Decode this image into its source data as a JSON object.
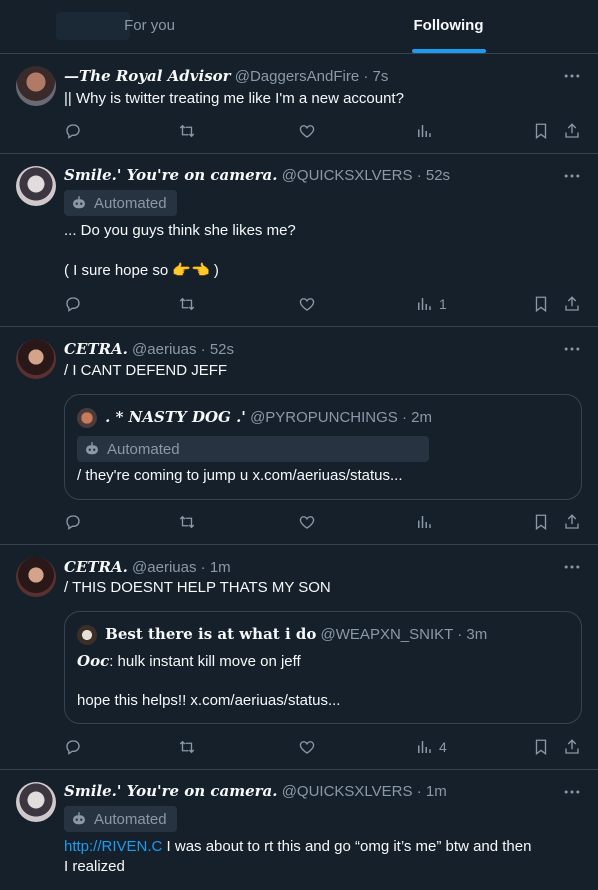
{
  "tabs": [
    {
      "label": "For you",
      "active": false
    },
    {
      "label": "Following",
      "active": true
    }
  ],
  "colors": {
    "background": "#15202b",
    "accent": "#1d9bf0",
    "muted": "#8b98a5",
    "border": "#38444d"
  },
  "tweets": [
    {
      "name": "—The Royal Advisor",
      "handle": "@DaggersAndFire",
      "time": "· 7s",
      "text": "|| Why is twitter treating me like I'm a new account?",
      "actions": {
        "reply": "",
        "retweet": "",
        "like": "",
        "views": ""
      }
    },
    {
      "name": "Smile.' You're on camera.",
      "handle": "@QUICKSXLVERS",
      "time": "· 52s",
      "badge": "Automated",
      "text_line1": "... Do you guys think she likes me?",
      "text_line2": "( I sure hope so",
      "text_emoji": "👉👈",
      "text_line2_end": " )",
      "actions": {
        "views": "1"
      }
    },
    {
      "name": "CETRA.",
      "handle": "@aeriuas",
      "time": "· 52s",
      "text": "/ I CANT DEFEND JEFF",
      "quote": {
        "name": ". * NASTY DOG .'",
        "handle": "@PYROPUNCHINGS",
        "time": "· 2m",
        "badge": "Automated",
        "text": "/ they're coming to jump u x.com/aeriuas/status..."
      },
      "actions": {
        "views": ""
      }
    },
    {
      "name": "CETRA.",
      "handle": "@aeriuas",
      "time": "· 1m",
      "text": "/ THIS DOESNT HELP THATS MY SON",
      "quote": {
        "name": "Best there is at what i do",
        "handle": "@WEAPXN_SNIKT",
        "time": "· 3m",
        "ooc_label": "Ooc",
        "line1_rest": ": hulk instant kill move on jeff",
        "line2": "hope this helps!! x.com/aeriuas/status..."
      },
      "actions": {
        "views": "4"
      }
    },
    {
      "name": "Smile.' You're on camera.",
      "handle": "@QUICKSXLVERS",
      "time": "· 1m",
      "badge": "Automated",
      "link": "http://RIVEN.C",
      "text_after_link": " I was about to rt this and go “omg it’s me” btw and then",
      "text_line2": "I realized"
    }
  ]
}
